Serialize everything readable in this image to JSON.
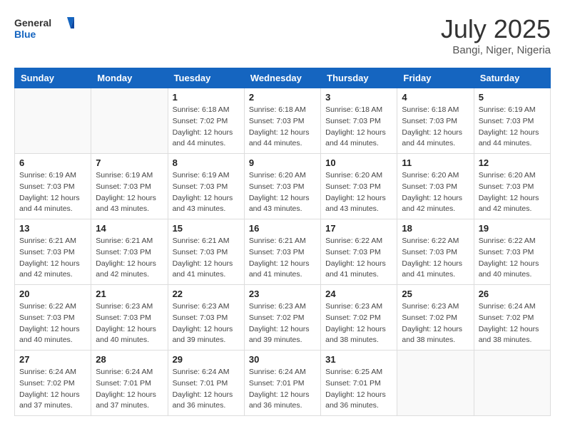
{
  "header": {
    "logo_general": "General",
    "logo_blue": "Blue",
    "title": "July 2025",
    "subtitle": "Bangi, Niger, Nigeria"
  },
  "days_of_week": [
    "Sunday",
    "Monday",
    "Tuesday",
    "Wednesday",
    "Thursday",
    "Friday",
    "Saturday"
  ],
  "weeks": [
    [
      {
        "day": "",
        "detail": ""
      },
      {
        "day": "",
        "detail": ""
      },
      {
        "day": "1",
        "detail": "Sunrise: 6:18 AM\nSunset: 7:02 PM\nDaylight: 12 hours and 44 minutes."
      },
      {
        "day": "2",
        "detail": "Sunrise: 6:18 AM\nSunset: 7:03 PM\nDaylight: 12 hours and 44 minutes."
      },
      {
        "day": "3",
        "detail": "Sunrise: 6:18 AM\nSunset: 7:03 PM\nDaylight: 12 hours and 44 minutes."
      },
      {
        "day": "4",
        "detail": "Sunrise: 6:18 AM\nSunset: 7:03 PM\nDaylight: 12 hours and 44 minutes."
      },
      {
        "day": "5",
        "detail": "Sunrise: 6:19 AM\nSunset: 7:03 PM\nDaylight: 12 hours and 44 minutes."
      }
    ],
    [
      {
        "day": "6",
        "detail": "Sunrise: 6:19 AM\nSunset: 7:03 PM\nDaylight: 12 hours and 44 minutes."
      },
      {
        "day": "7",
        "detail": "Sunrise: 6:19 AM\nSunset: 7:03 PM\nDaylight: 12 hours and 43 minutes."
      },
      {
        "day": "8",
        "detail": "Sunrise: 6:19 AM\nSunset: 7:03 PM\nDaylight: 12 hours and 43 minutes."
      },
      {
        "day": "9",
        "detail": "Sunrise: 6:20 AM\nSunset: 7:03 PM\nDaylight: 12 hours and 43 minutes."
      },
      {
        "day": "10",
        "detail": "Sunrise: 6:20 AM\nSunset: 7:03 PM\nDaylight: 12 hours and 43 minutes."
      },
      {
        "day": "11",
        "detail": "Sunrise: 6:20 AM\nSunset: 7:03 PM\nDaylight: 12 hours and 42 minutes."
      },
      {
        "day": "12",
        "detail": "Sunrise: 6:20 AM\nSunset: 7:03 PM\nDaylight: 12 hours and 42 minutes."
      }
    ],
    [
      {
        "day": "13",
        "detail": "Sunrise: 6:21 AM\nSunset: 7:03 PM\nDaylight: 12 hours and 42 minutes."
      },
      {
        "day": "14",
        "detail": "Sunrise: 6:21 AM\nSunset: 7:03 PM\nDaylight: 12 hours and 42 minutes."
      },
      {
        "day": "15",
        "detail": "Sunrise: 6:21 AM\nSunset: 7:03 PM\nDaylight: 12 hours and 41 minutes."
      },
      {
        "day": "16",
        "detail": "Sunrise: 6:21 AM\nSunset: 7:03 PM\nDaylight: 12 hours and 41 minutes."
      },
      {
        "day": "17",
        "detail": "Sunrise: 6:22 AM\nSunset: 7:03 PM\nDaylight: 12 hours and 41 minutes."
      },
      {
        "day": "18",
        "detail": "Sunrise: 6:22 AM\nSunset: 7:03 PM\nDaylight: 12 hours and 41 minutes."
      },
      {
        "day": "19",
        "detail": "Sunrise: 6:22 AM\nSunset: 7:03 PM\nDaylight: 12 hours and 40 minutes."
      }
    ],
    [
      {
        "day": "20",
        "detail": "Sunrise: 6:22 AM\nSunset: 7:03 PM\nDaylight: 12 hours and 40 minutes."
      },
      {
        "day": "21",
        "detail": "Sunrise: 6:23 AM\nSunset: 7:03 PM\nDaylight: 12 hours and 40 minutes."
      },
      {
        "day": "22",
        "detail": "Sunrise: 6:23 AM\nSunset: 7:03 PM\nDaylight: 12 hours and 39 minutes."
      },
      {
        "day": "23",
        "detail": "Sunrise: 6:23 AM\nSunset: 7:02 PM\nDaylight: 12 hours and 39 minutes."
      },
      {
        "day": "24",
        "detail": "Sunrise: 6:23 AM\nSunset: 7:02 PM\nDaylight: 12 hours and 38 minutes."
      },
      {
        "day": "25",
        "detail": "Sunrise: 6:23 AM\nSunset: 7:02 PM\nDaylight: 12 hours and 38 minutes."
      },
      {
        "day": "26",
        "detail": "Sunrise: 6:24 AM\nSunset: 7:02 PM\nDaylight: 12 hours and 38 minutes."
      }
    ],
    [
      {
        "day": "27",
        "detail": "Sunrise: 6:24 AM\nSunset: 7:02 PM\nDaylight: 12 hours and 37 minutes."
      },
      {
        "day": "28",
        "detail": "Sunrise: 6:24 AM\nSunset: 7:01 PM\nDaylight: 12 hours and 37 minutes."
      },
      {
        "day": "29",
        "detail": "Sunrise: 6:24 AM\nSunset: 7:01 PM\nDaylight: 12 hours and 36 minutes."
      },
      {
        "day": "30",
        "detail": "Sunrise: 6:24 AM\nSunset: 7:01 PM\nDaylight: 12 hours and 36 minutes."
      },
      {
        "day": "31",
        "detail": "Sunrise: 6:25 AM\nSunset: 7:01 PM\nDaylight: 12 hours and 36 minutes."
      },
      {
        "day": "",
        "detail": ""
      },
      {
        "day": "",
        "detail": ""
      }
    ]
  ]
}
